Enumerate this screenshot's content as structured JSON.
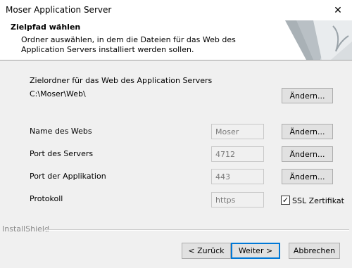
{
  "window": {
    "title": "Moser Application Server"
  },
  "header": {
    "title": "Zielpfad wählen",
    "subtitle": "Ordner auswählen, in dem die Dateien für das Web des Application Servers installiert werden sollen."
  },
  "folder": {
    "label": "Zielordner für das Web des Application Servers",
    "path": "C:\\Moser\\Web\\",
    "change_label": "Ändern..."
  },
  "settings": {
    "web_name": {
      "label": "Name des Webs",
      "value": "Moser",
      "change_label": "Ändern..."
    },
    "server_port": {
      "label": "Port des Servers",
      "value": "4712",
      "change_label": "Ändern..."
    },
    "app_port": {
      "label": "Port der Applikation",
      "value": "443",
      "change_label": "Ändern..."
    },
    "protocol": {
      "label": "Protokoll",
      "value": "https"
    },
    "ssl": {
      "label": "SSL Zertifikat",
      "checked": true
    }
  },
  "footer": {
    "brand": "InstallShield",
    "back_label": "< Zurück",
    "next_label": "Weiter >",
    "cancel_label": "Abbrechen"
  },
  "icons": {
    "close": "close-icon",
    "checkbox_mark": "checkmark-icon",
    "banner": "page-curl-art"
  }
}
